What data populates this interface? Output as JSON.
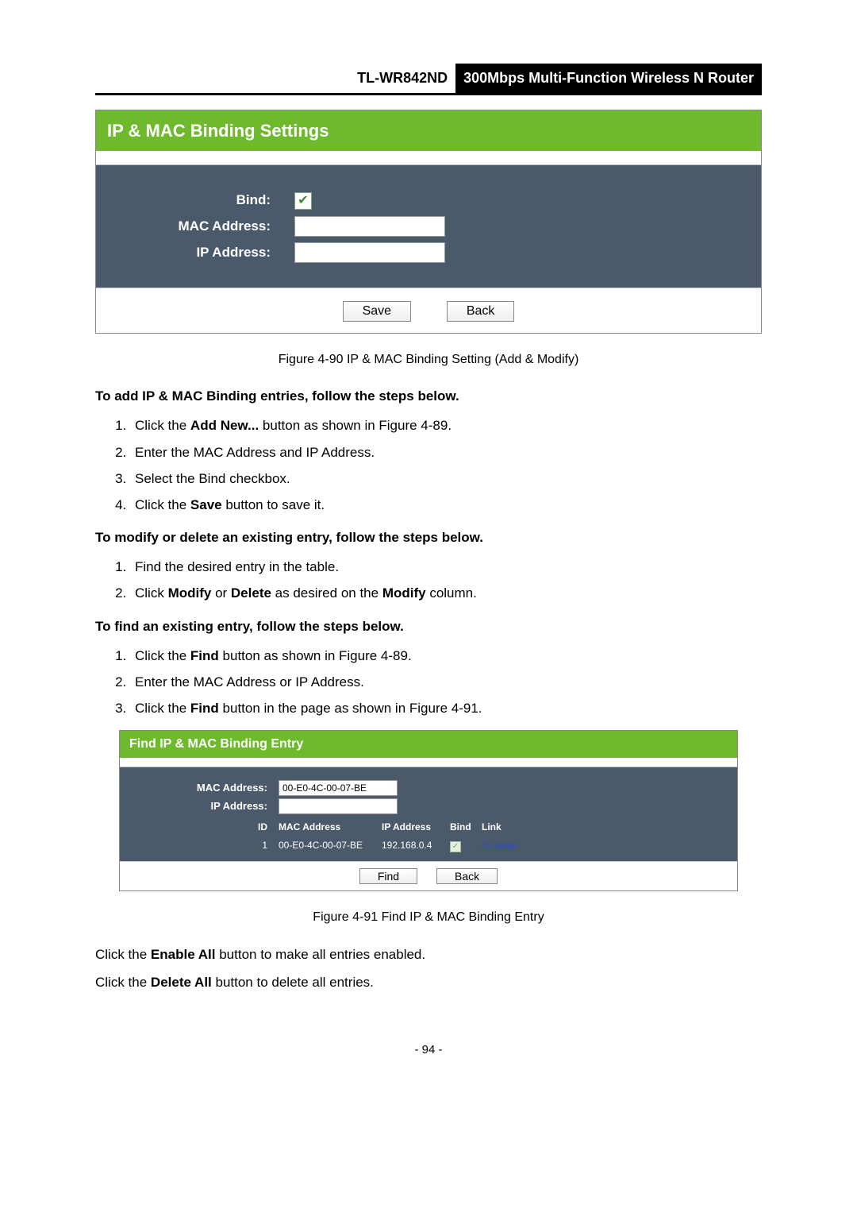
{
  "header": {
    "model": "TL-WR842ND",
    "desc": "300Mbps Multi-Function Wireless N Router"
  },
  "panel1": {
    "title": "IP & MAC Binding Settings",
    "fields": {
      "bind_label": "Bind:",
      "mac_label": "MAC Address:",
      "ip_label": "IP Address:",
      "mac_value": "",
      "ip_value": ""
    },
    "buttons": {
      "save": "Save",
      "back": "Back"
    }
  },
  "fig1": "Figure 4-90    IP & MAC Binding Setting (Add & Modify)",
  "section_add_title": "To add IP & MAC Binding entries, follow the steps below.",
  "add_steps": {
    "s1a": "Click the ",
    "s1b": "Add New...",
    "s1c": " button as shown in Figure 4-89.",
    "s2": "Enter the MAC Address and IP Address.",
    "s3": "Select the Bind checkbox.",
    "s4a": "Click the ",
    "s4b": "Save",
    "s4c": " button to save it."
  },
  "section_mod_title": "To modify or delete an existing entry, follow the steps below.",
  "mod_steps": {
    "s1": "Find the desired entry in the table.",
    "s2a": "Click ",
    "s2b": "Modify",
    "s2c": " or ",
    "s2d": "Delete",
    "s2e": " as desired on the ",
    "s2f": "Modify",
    "s2g": " column."
  },
  "section_find_title": "To find an existing entry, follow the steps below.",
  "find_steps": {
    "s1a": "Click the ",
    "s1b": "Find",
    "s1c": " button as shown in Figure 4-89.",
    "s2": "Enter the MAC Address or IP Address.",
    "s3a": "Click the ",
    "s3b": "Find",
    "s3c": " button in the page as shown in Figure 4-91."
  },
  "panel2": {
    "title": "Find IP & MAC Binding Entry",
    "mac_label": "MAC Address:",
    "ip_label": "IP Address:",
    "mac_value": "00-E0-4C-00-07-BE",
    "ip_value": "",
    "col_id": "ID",
    "col_mac": "MAC Address",
    "col_ip": "IP Address",
    "col_bind": "Bind",
    "col_link": "Link",
    "row_id": "1",
    "row_mac": "00-E0-4C-00-07-BE",
    "row_ip": "192.168.0.4",
    "row_link": "To page",
    "buttons": {
      "find": "Find",
      "back": "Back"
    }
  },
  "fig2": "Figure 4-91    Find IP & MAC Binding Entry",
  "enable_all": {
    "a": "Click the ",
    "b": "Enable All",
    "c": " button to make all entries enabled."
  },
  "delete_all": {
    "a": "Click the ",
    "b": "Delete All",
    "c": " button to delete all entries."
  },
  "page_number": "- 94 -"
}
